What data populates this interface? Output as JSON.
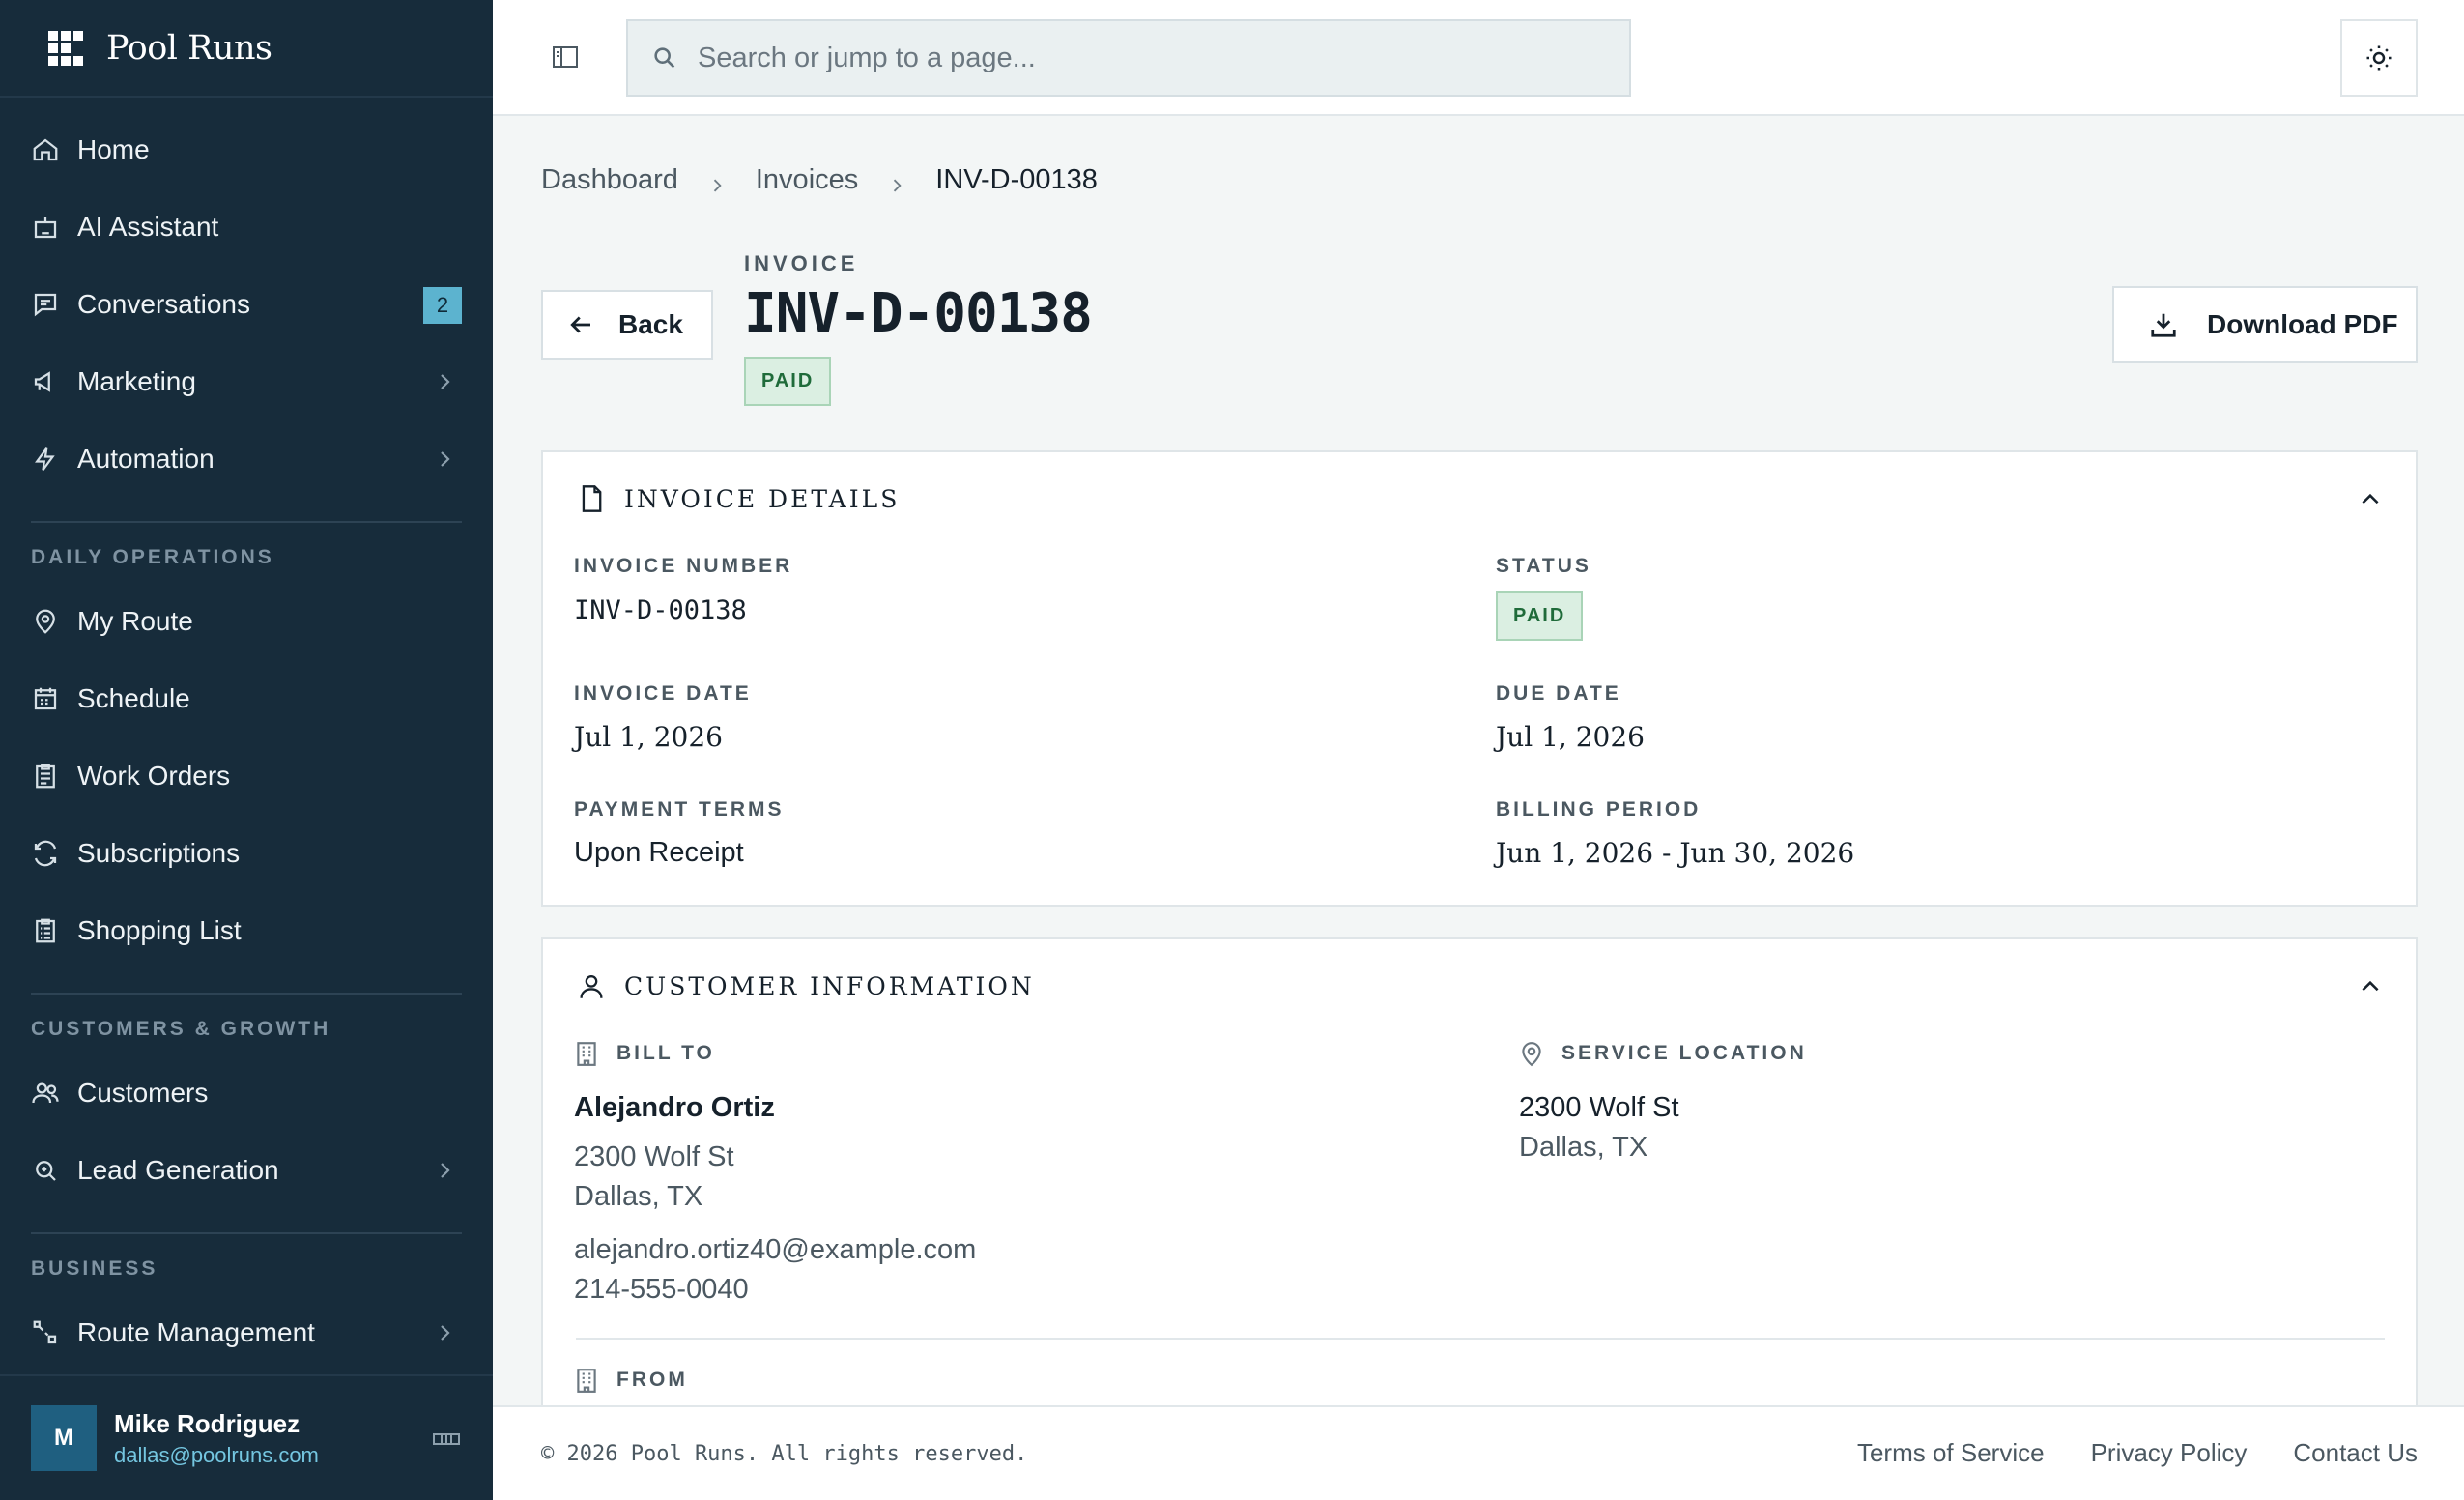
{
  "app": {
    "name": "Pool Runs"
  },
  "sidebar": {
    "items": [
      {
        "label": "Home",
        "icon": "home-icon"
      },
      {
        "label": "AI Assistant",
        "icon": "robot-icon"
      },
      {
        "label": "Conversations",
        "icon": "chat-icon",
        "badge": "2"
      },
      {
        "label": "Marketing",
        "icon": "megaphone-icon"
      },
      {
        "label": "Automation",
        "icon": "lightning-icon"
      }
    ],
    "sections": [
      {
        "title": "DAILY OPERATIONS",
        "items": [
          {
            "label": "My Route",
            "icon": "map-pin-icon"
          },
          {
            "label": "Schedule",
            "icon": "calendar-icon"
          },
          {
            "label": "Work Orders",
            "icon": "clipboard-icon"
          },
          {
            "label": "Subscriptions",
            "icon": "refresh-icon"
          },
          {
            "label": "Shopping List",
            "icon": "list-icon"
          }
        ]
      },
      {
        "title": "CUSTOMERS & GROWTH",
        "items": [
          {
            "label": "Customers",
            "icon": "users-icon"
          },
          {
            "label": "Lead Generation",
            "icon": "search-icon"
          }
        ]
      },
      {
        "title": "BUSINESS",
        "items": [
          {
            "label": "Route Management",
            "icon": "route-icon"
          }
        ]
      }
    ],
    "user": {
      "initial": "M",
      "name": "Mike Rodriguez",
      "email": "dallas@poolruns.com"
    }
  },
  "topbar": {
    "search_placeholder": "Search or jump to a page..."
  },
  "breadcrumb": [
    "Dashboard",
    "Invoices",
    "INV-D-00138"
  ],
  "header": {
    "back_label": "Back",
    "kicker": "INVOICE",
    "title": "INV-D-00138",
    "status": "PAID",
    "download_label": "Download PDF"
  },
  "invoice_details": {
    "title": "INVOICE DETAILS",
    "invoice_number_label": "INVOICE NUMBER",
    "invoice_number": "INV-D-00138",
    "status_label": "STATUS",
    "status": "PAID",
    "invoice_date_label": "INVOICE DATE",
    "invoice_date": "Jul 1, 2026",
    "due_date_label": "DUE DATE",
    "due_date": "Jul 1, 2026",
    "payment_terms_label": "PAYMENT TERMS",
    "payment_terms": "Upon Receipt",
    "billing_period_label": "BILLING PERIOD",
    "billing_period": "Jun 1, 2026 - Jun 30, 2026"
  },
  "customer_info": {
    "title": "CUSTOMER INFORMATION",
    "bill_to_label": "BILL TO",
    "name": "Alejandro Ortiz",
    "address1": "2300 Wolf St",
    "address2": "Dallas, TX",
    "email": "alejandro.ortiz40@example.com",
    "phone": "214-555-0040",
    "service_location_label": "SERVICE LOCATION",
    "service_address1": "2300 Wolf St",
    "service_address2": "Dallas, TX",
    "from_label": "FROM"
  },
  "footer": {
    "copyright": "© 2026 Pool Runs. All rights reserved.",
    "links": [
      "Terms of Service",
      "Privacy Policy",
      "Contact Us"
    ]
  },
  "colors": {
    "sidebar_bg": "#172c3b",
    "badge": "#5cb3cf",
    "paid_bg": "#dbefe2",
    "paid_text": "#1f6b3a"
  }
}
